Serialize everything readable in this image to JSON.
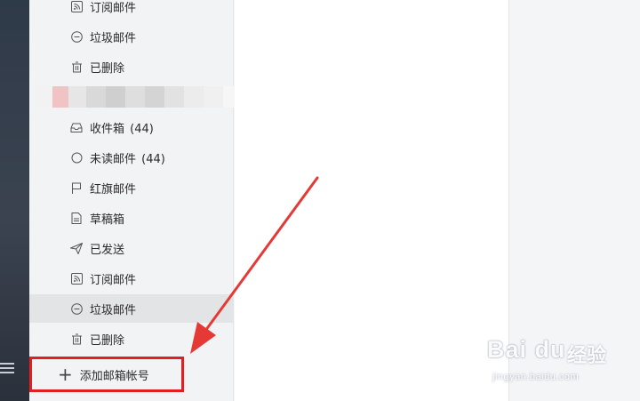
{
  "colors": {
    "rail": "#333c4a",
    "sidebar": "#f2f3f5",
    "active_item": "#e3e4e6",
    "highlight_box": "#e02020",
    "arrow": "#e53935"
  },
  "sidebar": {
    "top_items": [
      {
        "label": "订阅邮件",
        "icon": "rss-icon"
      },
      {
        "label": "垃圾邮件",
        "icon": "minus-circle-icon"
      },
      {
        "label": "已删除",
        "icon": "trash-icon"
      }
    ],
    "items": [
      {
        "label": "收件箱",
        "count": "(44)",
        "icon": "inbox-icon"
      },
      {
        "label": "未读邮件",
        "count": "(44)",
        "icon": "circle-icon"
      },
      {
        "label": "红旗邮件",
        "icon": "flag-icon"
      },
      {
        "label": "草稿箱",
        "icon": "draft-icon"
      },
      {
        "label": "已发送",
        "icon": "send-icon"
      },
      {
        "label": "订阅邮件",
        "icon": "rss-icon"
      },
      {
        "label": "垃圾邮件",
        "icon": "minus-circle-icon",
        "active": true
      },
      {
        "label": "已删除",
        "icon": "trash-icon"
      }
    ],
    "add_account_label": "添加邮箱帐号"
  },
  "watermark": {
    "brand": "Bai du",
    "brand_cn": "经验",
    "url": "jingyan.baidu.com"
  }
}
